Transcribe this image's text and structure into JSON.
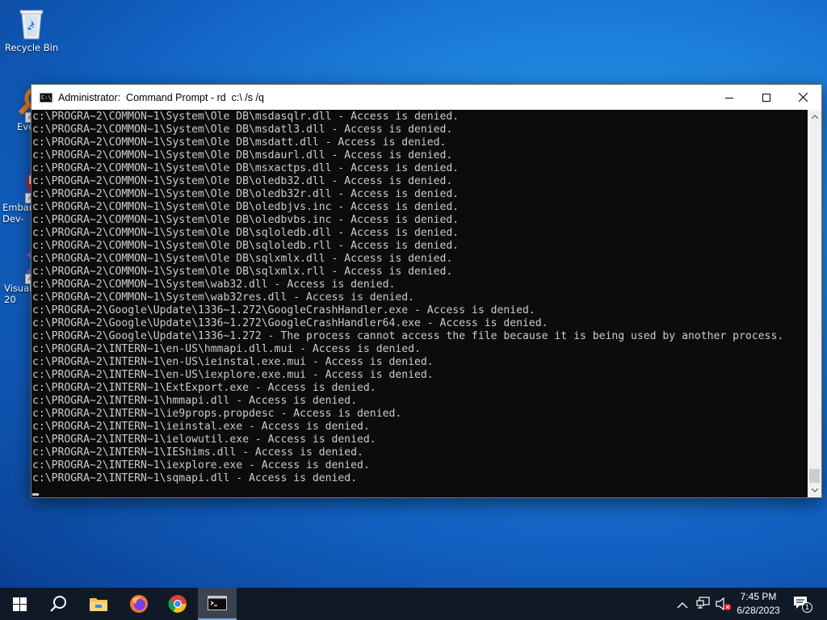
{
  "desktop": {
    "icons": [
      {
        "label": "Recycle Bin",
        "icon": "recycle-bin-icon"
      },
      {
        "label": "Every",
        "icon": "everything-app-icon"
      },
      {
        "label": "Embar\nDev-",
        "icon": "embarcadero-dev-cpp-icon"
      },
      {
        "label": "Visual\n20",
        "icon": "visual-studio-icon"
      }
    ]
  },
  "window": {
    "title": "Administrator:  Command Prompt - rd  c:\\ /s /q",
    "icon": "cmd-window-icon",
    "controls": [
      "minimize-icon",
      "maximize-icon",
      "close-icon"
    ]
  },
  "console": {
    "lines": [
      "c:\\PROGRA~2\\COMMON~1\\System\\Ole DB\\msdasqlr.dll - Access is denied.",
      "c:\\PROGRA~2\\COMMON~1\\System\\Ole DB\\msdatl3.dll - Access is denied.",
      "c:\\PROGRA~2\\COMMON~1\\System\\Ole DB\\msdatt.dll - Access is denied.",
      "c:\\PROGRA~2\\COMMON~1\\System\\Ole DB\\msdaurl.dll - Access is denied.",
      "c:\\PROGRA~2\\COMMON~1\\System\\Ole DB\\msxactps.dll - Access is denied.",
      "c:\\PROGRA~2\\COMMON~1\\System\\Ole DB\\oledb32.dll - Access is denied.",
      "c:\\PROGRA~2\\COMMON~1\\System\\Ole DB\\oledb32r.dll - Access is denied.",
      "c:\\PROGRA~2\\COMMON~1\\System\\Ole DB\\oledbjvs.inc - Access is denied.",
      "c:\\PROGRA~2\\COMMON~1\\System\\Ole DB\\oledbvbs.inc - Access is denied.",
      "c:\\PROGRA~2\\COMMON~1\\System\\Ole DB\\sqloledb.dll - Access is denied.",
      "c:\\PROGRA~2\\COMMON~1\\System\\Ole DB\\sqloledb.rll - Access is denied.",
      "c:\\PROGRA~2\\COMMON~1\\System\\Ole DB\\sqlxmlx.dll - Access is denied.",
      "c:\\PROGRA~2\\COMMON~1\\System\\Ole DB\\sqlxmlx.rll - Access is denied.",
      "c:\\PROGRA~2\\COMMON~1\\System\\wab32.dll - Access is denied.",
      "c:\\PROGRA~2\\COMMON~1\\System\\wab32res.dll - Access is denied.",
      "c:\\PROGRA~2\\Google\\Update\\1336~1.272\\GoogleCrashHandler.exe - Access is denied.",
      "c:\\PROGRA~2\\Google\\Update\\1336~1.272\\GoogleCrashHandler64.exe - Access is denied.",
      "c:\\PROGRA~2\\Google\\Update\\1336~1.272 - The process cannot access the file because it is being used by another process.",
      "c:\\PROGRA~2\\INTERN~1\\en-US\\hmmapi.dll.mui - Access is denied.",
      "c:\\PROGRA~2\\INTERN~1\\en-US\\ieinstal.exe.mui - Access is denied.",
      "c:\\PROGRA~2\\INTERN~1\\en-US\\iexplore.exe.mui - Access is denied.",
      "c:\\PROGRA~2\\INTERN~1\\ExtExport.exe - Access is denied.",
      "c:\\PROGRA~2\\INTERN~1\\hmmapi.dll - Access is denied.",
      "c:\\PROGRA~2\\INTERN~1\\ie9props.propdesc - Access is denied.",
      "c:\\PROGRA~2\\INTERN~1\\ieinstal.exe - Access is denied.",
      "c:\\PROGRA~2\\INTERN~1\\ielowutil.exe - Access is denied.",
      "c:\\PROGRA~2\\INTERN~1\\IEShims.dll - Access is denied.",
      "c:\\PROGRA~2\\INTERN~1\\iexplore.exe - Access is denied.",
      "c:\\PROGRA~2\\INTERN~1\\sqmapi.dll - Access is denied."
    ],
    "text_color": "#cccccc",
    "background_color": "#0c0c0c"
  },
  "taskbar": {
    "start_icon": "windows-start-icon",
    "pinned": [
      {
        "icon": "search-icon"
      },
      {
        "icon": "file-explorer-icon"
      },
      {
        "icon": "firefox-icon"
      },
      {
        "icon": "chrome-icon"
      },
      {
        "icon": "command-prompt-icon",
        "active": true
      }
    ],
    "tray": {
      "icons": [
        "show-hidden-icons-chevron-icon",
        "network-icon",
        "volume-muted-icon"
      ],
      "time": "7:45 PM",
      "date": "6/28/2023",
      "notification_count": "1"
    },
    "background_color": "#101a26"
  }
}
